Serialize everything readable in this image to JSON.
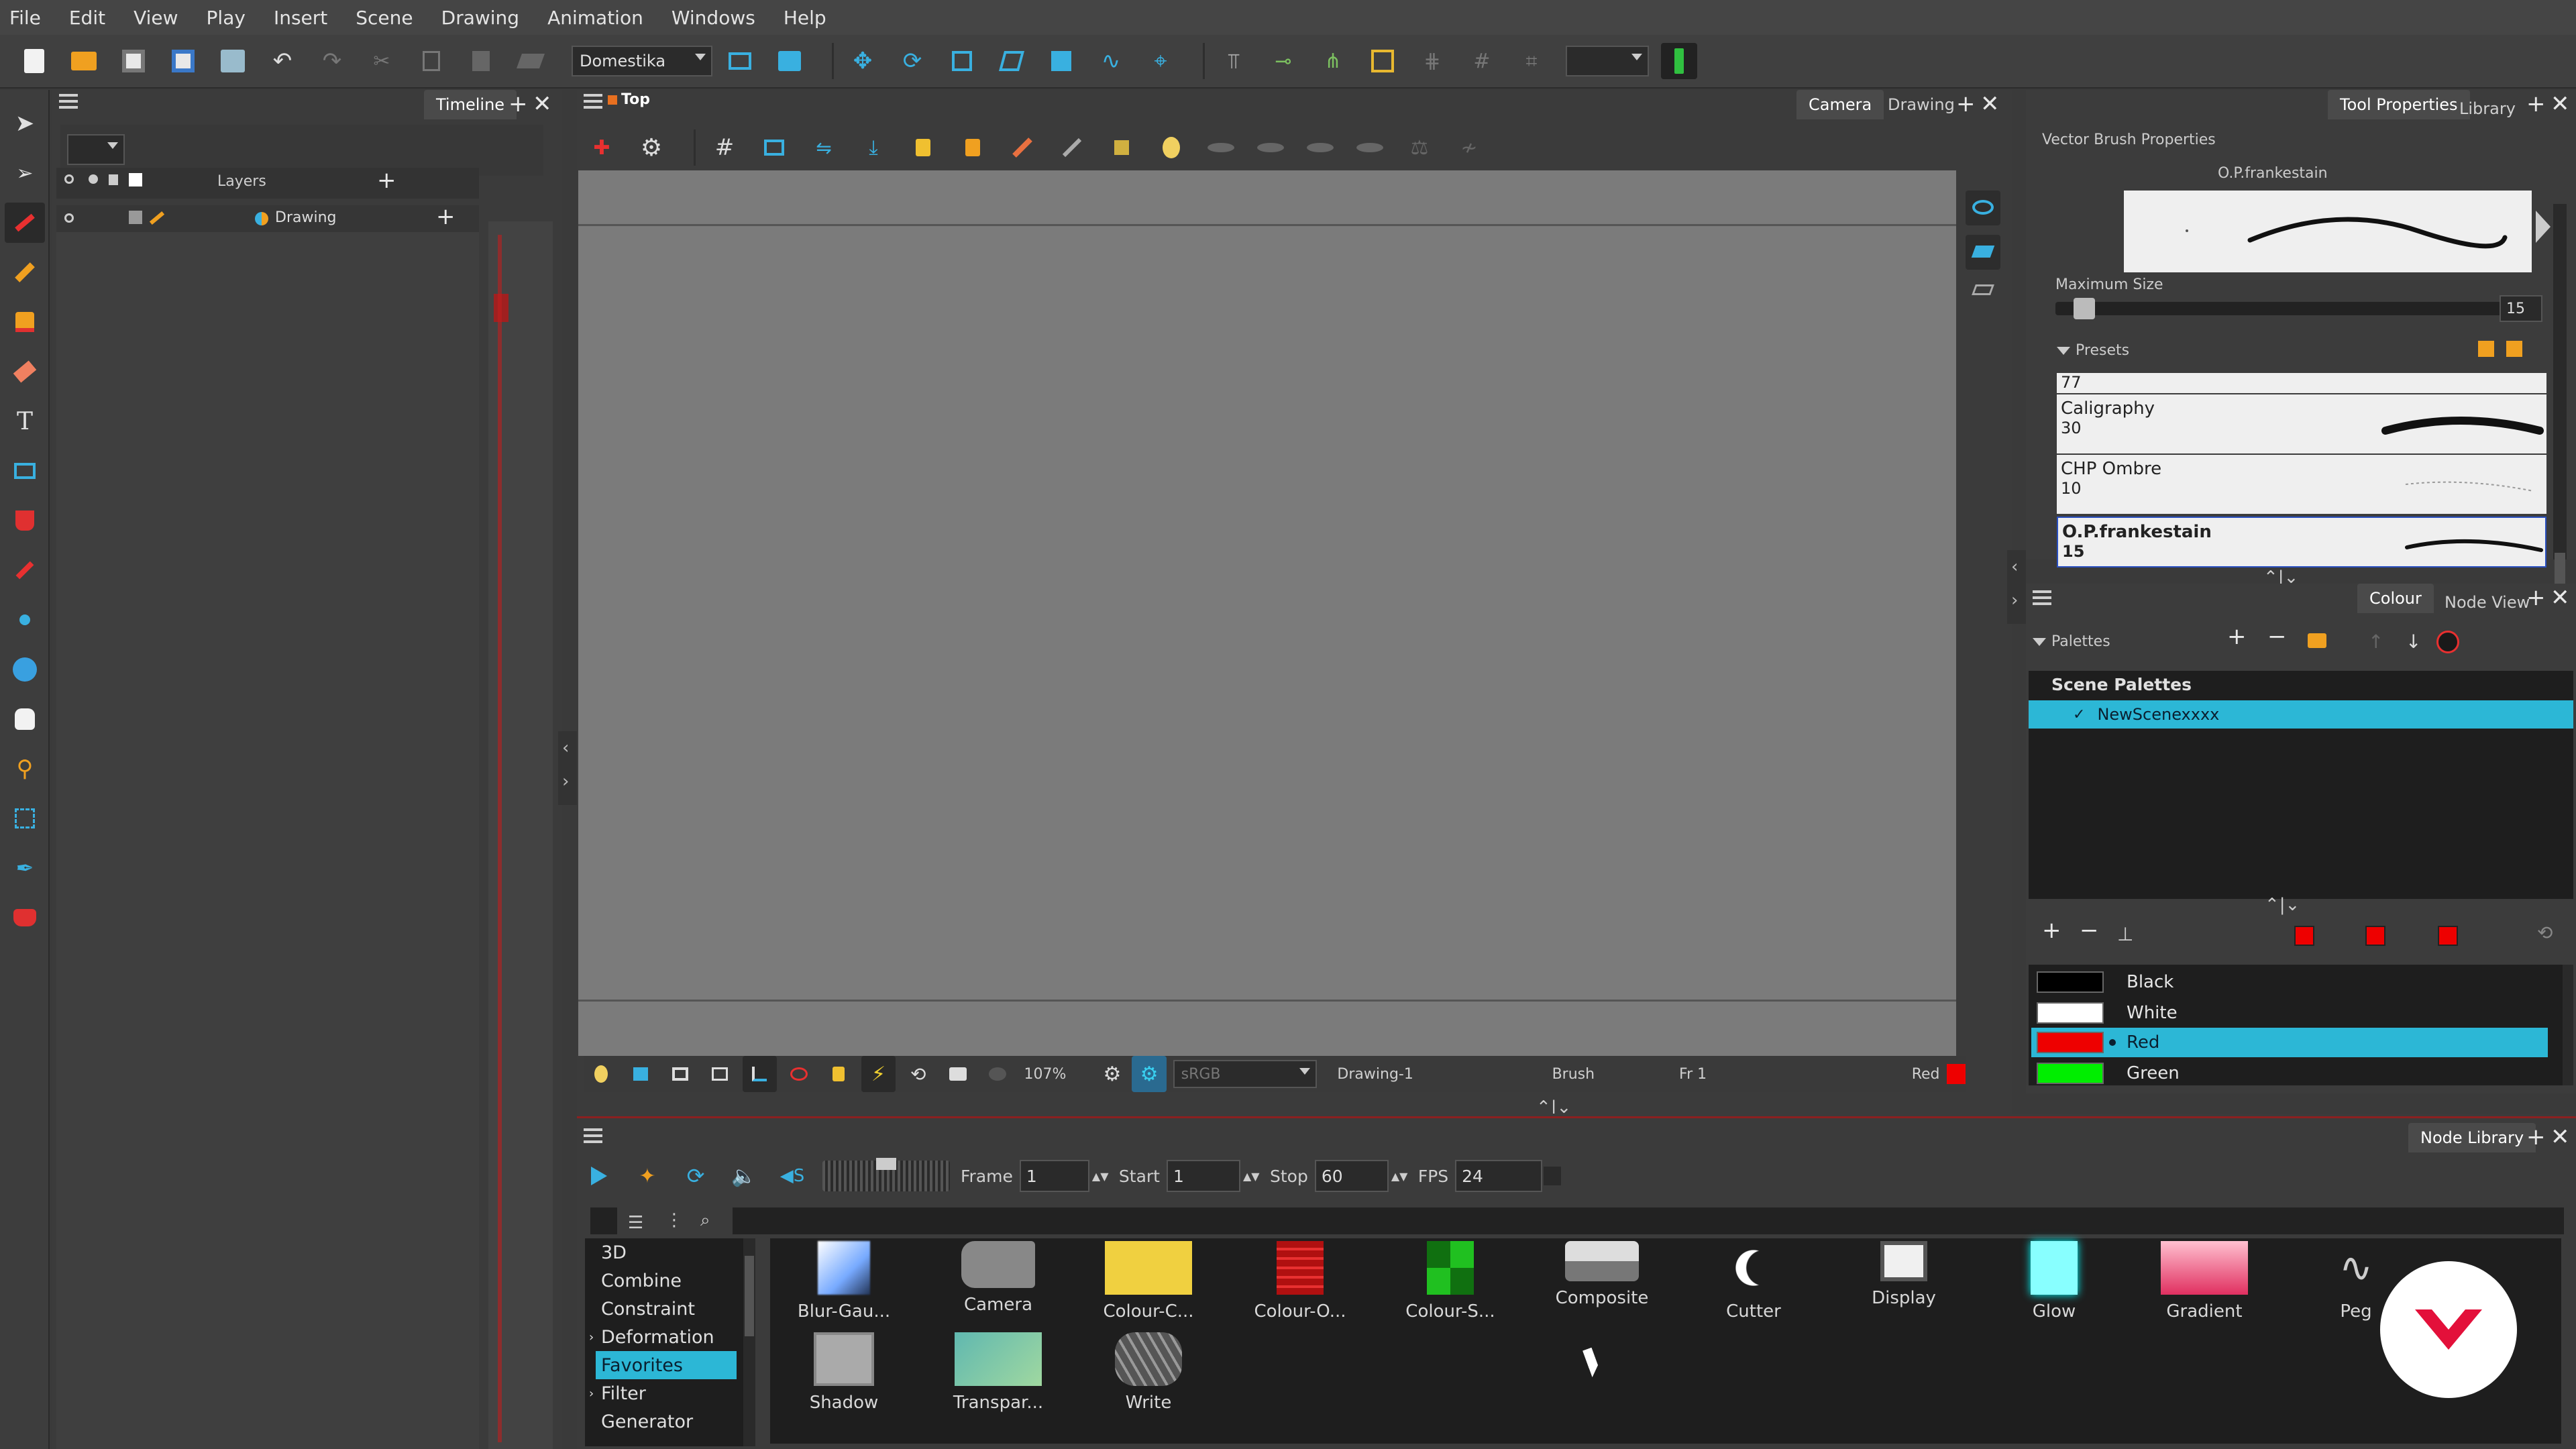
{
  "menu": [
    "File",
    "Edit",
    "View",
    "Play",
    "Insert",
    "Scene",
    "Drawing",
    "Animation",
    "Windows",
    "Help"
  ],
  "toolbar": {
    "workspace": "Domestika"
  },
  "timeline": {
    "tab": "Timeline",
    "layers_label": "Layers",
    "layer_name": "Drawing"
  },
  "view": {
    "title": "Top",
    "tabs": [
      "Camera",
      "Drawing"
    ],
    "status": {
      "zoom": "107%",
      "colorspace": "sRGB",
      "drawing": "Drawing-1",
      "tool": "Brush",
      "frame": "Fr 1",
      "colour_name": "Red"
    }
  },
  "tool_properties": {
    "tabs": [
      "Tool Properties",
      "Library"
    ],
    "title": "Vector Brush Properties",
    "brush_name": "O.P.frankestain",
    "max_size_label": "Maximum Size",
    "max_size_value": "15",
    "max_size_fraction": 0.04,
    "presets_label": "Presets",
    "presets": [
      {
        "name": "",
        "size": "77"
      },
      {
        "name": "Caligraphy",
        "size": "30"
      },
      {
        "name": "CHP Ombre",
        "size": "10"
      },
      {
        "name": "O.P.frankestain",
        "size": "15"
      }
    ]
  },
  "colour": {
    "tabs": [
      "Colour",
      "Node View"
    ],
    "palettes_label": "Palettes",
    "scene_palettes_label": "Scene Palettes",
    "palette_name": "NewScenexxxx",
    "swatches": [
      {
        "name": "Black",
        "color": "#000000"
      },
      {
        "name": "White",
        "color": "#ffffff"
      },
      {
        "name": "Red",
        "color": "#ee0000"
      },
      {
        "name": "Green",
        "color": "#00ee00"
      }
    ]
  },
  "playback": {
    "frame_label": "Frame",
    "frame": "1",
    "start_label": "Start",
    "start": "1",
    "stop_label": "Stop",
    "stop": "60",
    "fps_label": "FPS",
    "fps": "24"
  },
  "node_library": {
    "tab": "Node Library",
    "categories": [
      "3D",
      "Combine",
      "Constraint",
      "Deformation",
      "Favorites",
      "Filter",
      "Generator"
    ],
    "selected_category": "Favorites",
    "nodes_row1": [
      "Blur-Gau...",
      "Camera",
      "Colour-C...",
      "Colour-O...",
      "Colour-S...",
      "Composite",
      "Cutter",
      "Display",
      "Glow",
      "Gradient",
      "Peg"
    ],
    "nodes_row2": [
      "Shadow",
      "Transpar...",
      "Write"
    ]
  },
  "colors": {
    "accent": "#2cb7d6",
    "canvas": "#7b7b7b",
    "brand": "#e3103a"
  }
}
